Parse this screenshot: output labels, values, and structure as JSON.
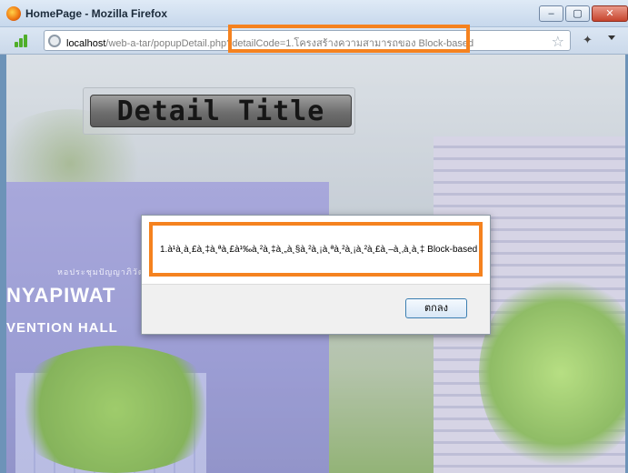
{
  "window": {
    "title": "HomePage - Mozilla Firefox",
    "minimize_label": "‒",
    "maximize_label": "▢",
    "close_label": "✕"
  },
  "address_bar": {
    "host": "localhost",
    "path": "/web-a-tar/popupDetail.php?",
    "query": "detailCode=1.โครงสร้างความสามารถของ Block-based"
  },
  "page": {
    "detail_title": "Detail Title",
    "background_sign": {
      "thai_text": "หอประชุมปัญญาภิวัฒน์",
      "line1": "NYAPIWAT",
      "line2": "VENTION HALL"
    }
  },
  "dialog": {
    "message": "1.à¹à¸à¸£à¸‡à¸ªà¸£à¹‰à¸²à¸‡à¸„à¸§à¸²à¸¡à¸ªà¸²à¸¡à¸²à¸£à¸–à¸‚à¸­à¸‡ Block-based",
    "ok_label": "ตกลง"
  },
  "colors": {
    "highlight": "#f5821f",
    "ok_button_border": "#3c7fb1"
  },
  "icons": [
    "firefox-logo-icon",
    "signal-bars-icon",
    "globe-icon",
    "bookmark-star-icon",
    "addon-icon",
    "dropdown-arrow-icon"
  ]
}
